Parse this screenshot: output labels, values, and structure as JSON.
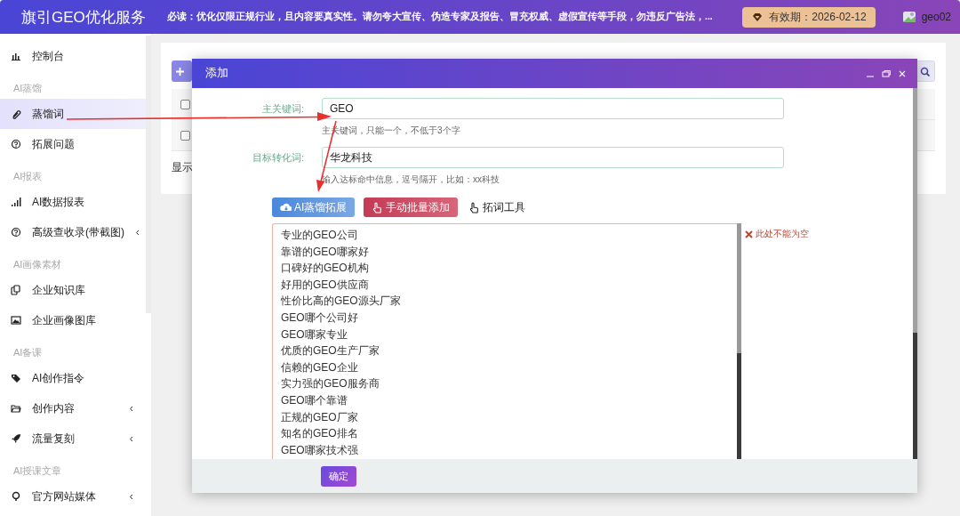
{
  "header": {
    "logo": "旗引GEO优化服务",
    "notice": "必读：优化仅限正规行业，且内容要真实性。请勿夸大宣传、伪造专家及报告、冒充权威、虚假宣传等手段，勿违反广告法，...",
    "expiry": "有效期：2026-02-12",
    "username": "geo02"
  },
  "sidebar": {
    "items": [
      {
        "kind": "item",
        "label": "控制台",
        "selected": false,
        "has_submenu": false
      },
      {
        "kind": "section",
        "label": "AI蒸馏"
      },
      {
        "kind": "item",
        "label": "蒸馏词",
        "selected": true,
        "has_submenu": false
      },
      {
        "kind": "item",
        "label": "拓展问题",
        "selected": false,
        "has_submenu": false
      },
      {
        "kind": "section",
        "label": "AI报表"
      },
      {
        "kind": "item",
        "label": "AI数据报表",
        "selected": false,
        "has_submenu": false
      },
      {
        "kind": "item",
        "label": "高级查收录(带截图)",
        "selected": false,
        "has_submenu": true
      },
      {
        "kind": "section",
        "label": "AI画像素材"
      },
      {
        "kind": "item",
        "label": "企业知识库",
        "selected": false,
        "has_submenu": false
      },
      {
        "kind": "item",
        "label": "企业画像图库",
        "selected": false,
        "has_submenu": false
      },
      {
        "kind": "section",
        "label": "AI备课"
      },
      {
        "kind": "item",
        "label": "AI创作指令",
        "selected": false,
        "has_submenu": false
      },
      {
        "kind": "item",
        "label": "创作内容",
        "selected": false,
        "has_submenu": true
      },
      {
        "kind": "item",
        "label": "流量复刻",
        "selected": false,
        "has_submenu": true
      },
      {
        "kind": "section",
        "label": "AI授课文章"
      },
      {
        "kind": "item",
        "label": "官方网站媒体",
        "selected": false,
        "has_submenu": true
      }
    ]
  },
  "page": {
    "rows": [
      {
        "checked": false
      },
      {
        "checked": false
      }
    ],
    "summary": "显示"
  },
  "dialog": {
    "title": "添加",
    "fields": [
      {
        "label": "主关键词:",
        "value": "GEO",
        "hint": "主关键词，只能一个，不低于3个字"
      },
      {
        "label": "目标转化词:",
        "value": "华龙科技",
        "hint": "输入达标命中信息，逗号隔开，比如：xx科技"
      }
    ],
    "actions": [
      {
        "kind": "primary",
        "label": "AI蒸馏拓展"
      },
      {
        "kind": "danger",
        "label": "手动批量添加"
      },
      {
        "kind": "link",
        "label": "拓词工具"
      }
    ],
    "keywords": [
      "专业的GEO公司",
      "靠谱的GEO哪家好",
      "口碑好的GEO机构",
      "好用的GEO供应商",
      "性价比高的GEO源头厂家",
      "GEO哪个公司好",
      "GEO哪家专业",
      "优质的GEO生产厂家",
      "信赖的GEO企业",
      "实力强的GEO服务商",
      "GEO哪个靠谱",
      "正规的GEO厂家",
      "知名的GEO排名",
      "GEO哪家技术强"
    ],
    "error": "此处不能为空",
    "submit": "确定"
  }
}
